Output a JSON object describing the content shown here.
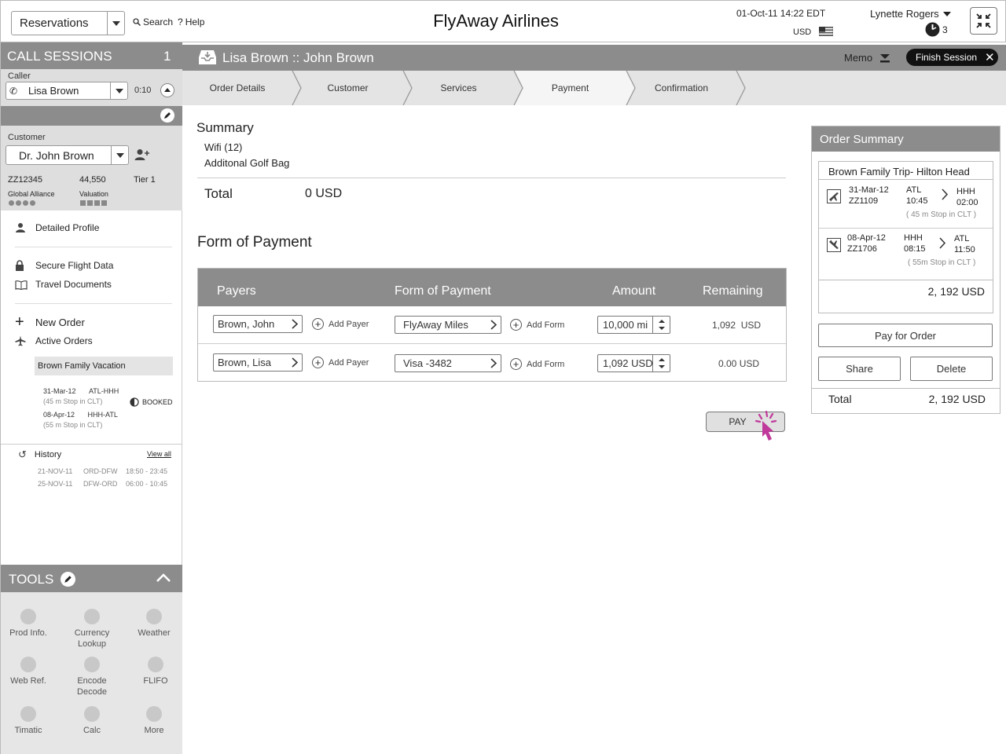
{
  "app": {
    "title": "FlyAway Airlines",
    "module_select": "Reservations",
    "search_label": "Search",
    "help_label": "Help",
    "datetime": "01-Oct-11 14:22 EDT",
    "currency": "USD",
    "user_name": "Lynette Rogers",
    "notification_count": "3"
  },
  "sidebar": {
    "call_sessions_title": "CALL SESSIONS",
    "call_sessions_count": "1",
    "caller_label": "Caller",
    "caller_name": "Lisa Brown",
    "caller_timer": "0:10",
    "customer_label": "Customer",
    "customer_name": "Dr. John Brown",
    "customer_id": "ZZ12345",
    "customer_points": "44,550",
    "customer_tier": "Tier 1",
    "alliance_label": "Global Alliance",
    "valuation_label": "Valuation",
    "links": {
      "detailed_profile": "Detailed Profile",
      "secure_flight": "Secure Flight Data",
      "travel_documents": "Travel Documents",
      "new_order": "New Order",
      "active_orders": "Active Orders"
    },
    "active_order": {
      "name": "Brown Family Vacation",
      "status": "BOOKED",
      "legs": [
        {
          "date": "31-Mar-12",
          "route": "ATL-HHH",
          "stop": "(45 m Stop in CLT)"
        },
        {
          "date": "08-Apr-12",
          "route": "HHH-ATL",
          "stop": "(55 m Stop in CLT)"
        }
      ]
    },
    "history": {
      "title": "History",
      "view_all": "View all",
      "rows": [
        {
          "date": "21-NOV-11",
          "route": "ORD-DFW",
          "time": "18:50 - 23:45"
        },
        {
          "date": "25-NOV-11",
          "route": "DFW-ORD",
          "time": "06:00 - 10:45"
        }
      ]
    },
    "tools": {
      "title": "TOOLS",
      "items": [
        "Prod Info.",
        "Currency Lookup",
        "Weather",
        "Web Ref.",
        "Encode Decode",
        "FLIFO",
        "Timatic",
        "Calc",
        "More"
      ]
    }
  },
  "session": {
    "title": "Lisa Brown :: John Brown",
    "memo_label": "Memo",
    "finish_label": "Finish Session"
  },
  "steps": [
    "Order Details",
    "Customer",
    "Services",
    "Payment",
    "Confirmation"
  ],
  "active_step": "Payment",
  "summary": {
    "title": "Summary",
    "items": [
      "Wifi (12)",
      "Additonal Golf Bag"
    ],
    "total_label": "Total",
    "total_value": "0 USD"
  },
  "payment": {
    "title": "Form of Payment",
    "headers": {
      "payers": "Payers",
      "form": "Form of Payment",
      "amount": "Amount",
      "remaining": "Remaining"
    },
    "add_payer_label": "Add Payer",
    "add_form_label": "Add Form",
    "rows": [
      {
        "payer": "Brown, John",
        "form": "FlyAway Miles",
        "amount": "10,000 mi",
        "remaining": "1,092  USD"
      },
      {
        "payer": "Brown, Lisa",
        "form": "Visa -3482",
        "amount": "1,092 USD",
        "remaining": "0.00 USD"
      }
    ],
    "pay_label": "PAY"
  },
  "order_summary": {
    "title": "Order Summary",
    "trip_name": "Brown Family Trip- Hilton Head",
    "flights": [
      {
        "date": "31-Mar-12",
        "flight": "ZZ1109",
        "from": "ATL",
        "dep": "10:45",
        "to": "HHH",
        "arr": "02:00",
        "stop": "( 45 m Stop in CLT )"
      },
      {
        "date": "08-Apr-12",
        "flight": "ZZ1706",
        "from": "HHH",
        "dep": "08:15",
        "to": "ATL",
        "arr": "11:50",
        "stop": "( 55m Stop in CLT )"
      }
    ],
    "subtotal": "2, 192 USD",
    "pay_order_label": "Pay for Order",
    "share_label": "Share",
    "delete_label": "Delete",
    "total_label": "Total",
    "total_value": "2, 192 USD"
  }
}
